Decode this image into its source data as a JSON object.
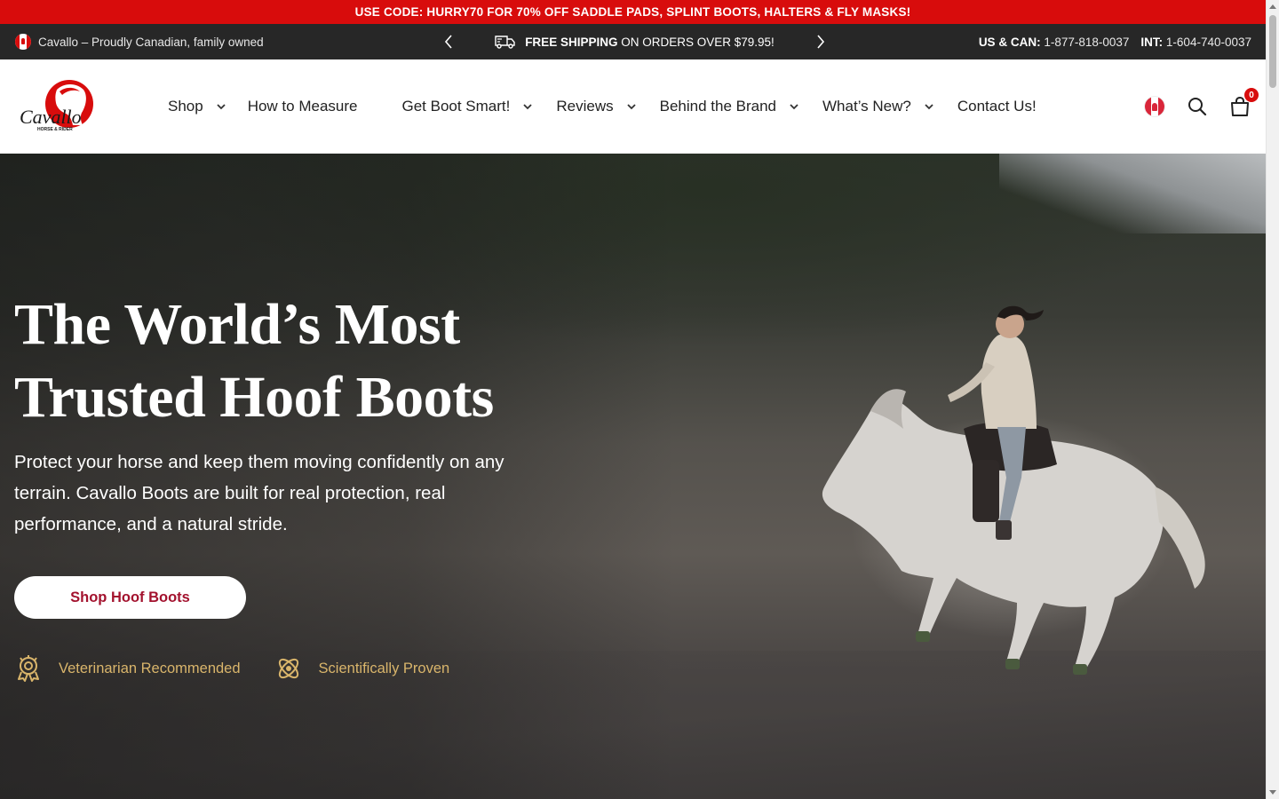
{
  "promo": {
    "text": "USE CODE: HURRY70 FOR 70% OFF SADDLE PADS, SPLINT BOOTS, HALTERS & FLY MASKS!"
  },
  "topbar": {
    "tagline": "Cavallo – Proudly Canadian, family owned",
    "shipping_bold": "FREE SHIPPING",
    "shipping_rest": "ON ORDERS OVER $79.95!",
    "us_label": "US & CAN:",
    "us_phone": "1-877-818-0037",
    "int_label": "INT:",
    "int_phone": "1-604-740-0037"
  },
  "logo": {
    "text": "Cavallo",
    "subtext": "HORSE & RIDER"
  },
  "nav": {
    "items": [
      {
        "label": "Shop",
        "dropdown": true
      },
      {
        "label": "How to Measure",
        "dropdown": false
      },
      {
        "label": "Get Boot Smart!",
        "dropdown": true
      },
      {
        "label": "Reviews",
        "dropdown": true
      },
      {
        "label": "Behind the Brand",
        "dropdown": true
      },
      {
        "label": "What’s New?",
        "dropdown": true
      },
      {
        "label": "Contact Us!",
        "dropdown": false
      }
    ]
  },
  "cart": {
    "count": "0"
  },
  "hero": {
    "title_line1": "The World’s Most",
    "title_line2": "Trusted Hoof Boots",
    "subtitle": "Protect your horse and keep them moving confidently on any terrain. Cavallo Boots are built for real protection, real performance, and a natural stride.",
    "cta": "Shop Hoof Boots",
    "badges": [
      {
        "icon": "vet-badge-icon",
        "label": "Veterinarian Recommended"
      },
      {
        "icon": "atom-icon",
        "label": "Scientifically Proven"
      }
    ]
  },
  "colors": {
    "promo_red": "#d80c0c",
    "topbar": "#272727",
    "cta_text": "#a3122e",
    "badge_gold": "#d9b56b"
  }
}
